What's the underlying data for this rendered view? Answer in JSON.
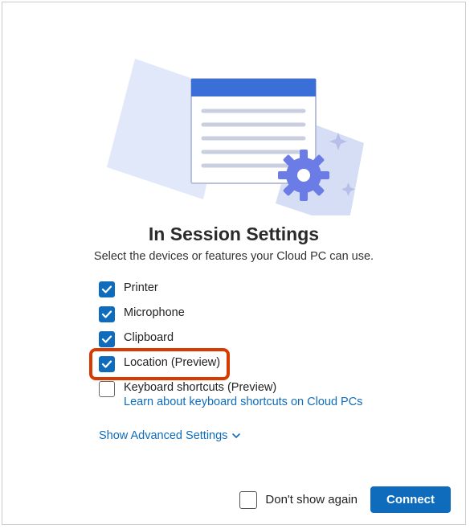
{
  "title": "In Session Settings",
  "subtitle": "Select the devices or features your Cloud PC can use.",
  "options": [
    {
      "id": "printer",
      "label": "Printer",
      "checked": true
    },
    {
      "id": "microphone",
      "label": "Microphone",
      "checked": true
    },
    {
      "id": "clipboard",
      "label": "Clipboard",
      "checked": true
    },
    {
      "id": "location",
      "label": "Location (Preview)",
      "checked": true,
      "highlighted": true
    },
    {
      "id": "keyboard",
      "label": "Keyboard shortcuts (Preview)",
      "checked": false,
      "link": "Learn about keyboard shortcuts on Cloud PCs"
    }
  ],
  "advanced_link": "Show Advanced Settings",
  "footer": {
    "dont_show_label": "Don't show again",
    "dont_show_checked": false,
    "connect_label": "Connect"
  },
  "colors": {
    "accent": "#0f6cbd",
    "highlight": "#d83b01"
  }
}
